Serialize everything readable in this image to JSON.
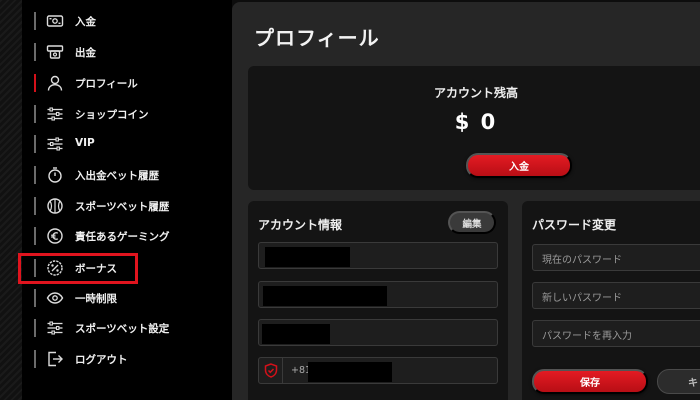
{
  "sidebar": {
    "items": [
      {
        "label": "入金",
        "icon": "cash-icon"
      },
      {
        "label": "出金",
        "icon": "withdraw-icon"
      },
      {
        "label": "プロフィール",
        "icon": "user-icon"
      },
      {
        "label": "ショップコイン",
        "icon": "sliders-icon"
      },
      {
        "label": "VIP",
        "icon": "sliders-icon"
      },
      {
        "label": "入出金ベット履歴",
        "icon": "stopwatch-icon"
      },
      {
        "label": "スポーツベット履歴",
        "icon": "basketball-icon"
      },
      {
        "label": "責任あるゲーミング",
        "icon": "euro-coin-icon"
      },
      {
        "label": "ボーナス",
        "icon": "percent-badge-icon"
      },
      {
        "label": "一時制限",
        "icon": "eye-icon"
      },
      {
        "label": "スポーツベット設定",
        "icon": "sliders-icon"
      },
      {
        "label": "ログアウト",
        "icon": "logout-icon"
      }
    ],
    "active_index": 2,
    "highlighted_index": 8
  },
  "main": {
    "title": "プロフィール",
    "balance": {
      "title": "アカウント残高",
      "amount": "$ 0",
      "deposit_label": "入金"
    },
    "account": {
      "title": "アカウント情報",
      "edit_label": "編集",
      "phone_prefix": "+81"
    },
    "password": {
      "title": "パスワード変更",
      "current_placeholder": "現在のパスワード",
      "new_placeholder": "新しいパスワード",
      "confirm_placeholder": "パスワードを再入力",
      "save_label": "保存",
      "secondary_label": "キ"
    }
  },
  "colors": {
    "accent": "#d4111a",
    "highlight_border": "#e0141e",
    "background": "#000000",
    "panel": "#262626"
  }
}
